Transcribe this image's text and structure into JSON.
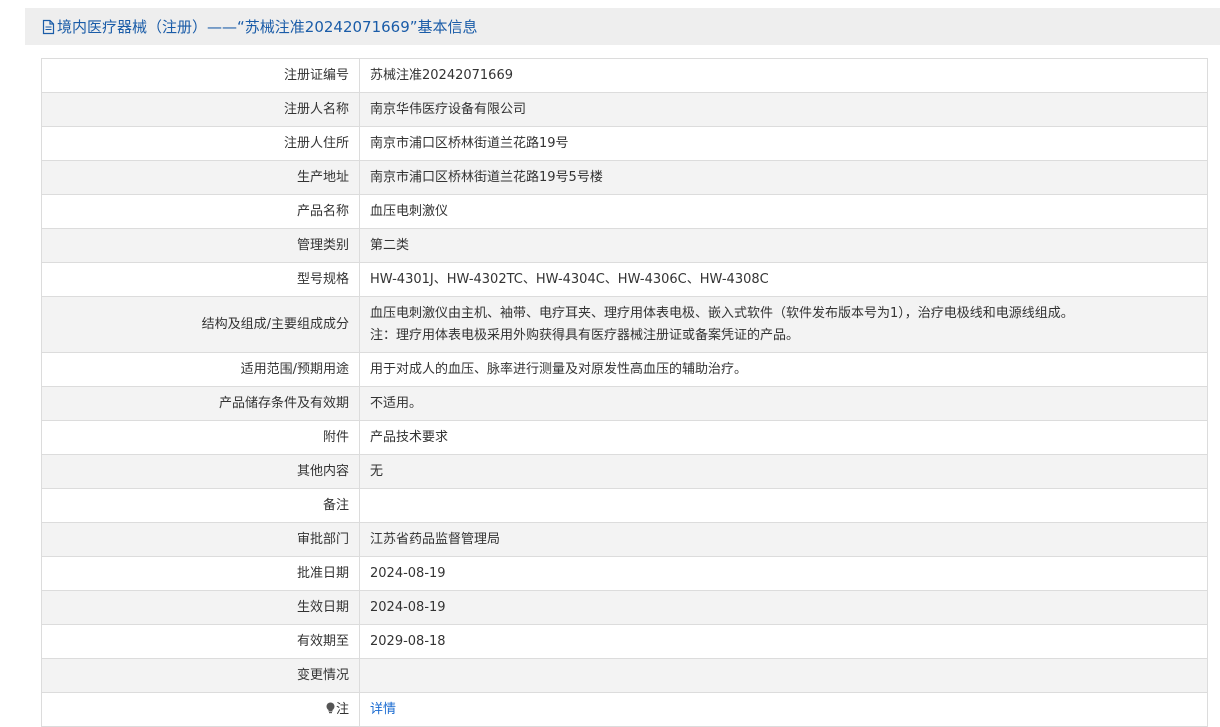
{
  "header": {
    "title": "境内医疗器械（注册）——“苏械注准20242071669”基本信息"
  },
  "rows": [
    {
      "label": "注册证编号",
      "value": "苏械注准20242071669"
    },
    {
      "label": "注册人名称",
      "value": "南京华伟医疗设备有限公司"
    },
    {
      "label": "注册人住所",
      "value": "南京市浦口区桥林街道兰花路19号"
    },
    {
      "label": "生产地址",
      "value": "南京市浦口区桥林街道兰花路19号5号楼"
    },
    {
      "label": "产品名称",
      "value": "血压电刺激仪"
    },
    {
      "label": "管理类别",
      "value": "第二类"
    },
    {
      "label": "型号规格",
      "value": "HW-4301J、HW-4302TC、HW-4304C、HW-4306C、HW-4308C"
    },
    {
      "label": "结构及组成/主要组成成分",
      "value": "血压电刺激仪由主机、袖带、电疗耳夹、理疗用体表电极、嵌入式软件（软件发布版本号为1），治疗电极线和电源线组成。",
      "value2": "注：理疗用体表电极采用外购获得具有医疗器械注册证或备案凭证的产品。"
    },
    {
      "label": "适用范围/预期用途",
      "value": "用于对成人的血压、脉率进行测量及对原发性高血压的辅助治疗。"
    },
    {
      "label": "产品储存条件及有效期",
      "value": "不适用。"
    },
    {
      "label": "附件",
      "value": "产品技术要求"
    },
    {
      "label": "其他内容",
      "value": "无"
    },
    {
      "label": "备注",
      "value": ""
    },
    {
      "label": "审批部门",
      "value": "江苏省药品监督管理局"
    },
    {
      "label": "批准日期",
      "value": "2024-08-19"
    },
    {
      "label": "生效日期",
      "value": "2024-08-19"
    },
    {
      "label": "有效期至",
      "value": "2029-08-18"
    },
    {
      "label": "变更情况",
      "value": ""
    },
    {
      "label": "注",
      "value": "详情"
    }
  ]
}
